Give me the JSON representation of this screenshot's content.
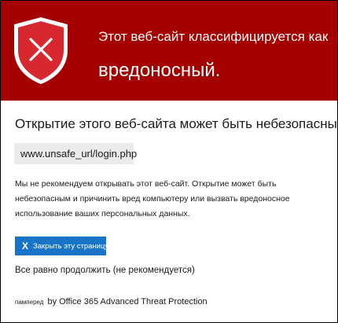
{
  "banner": {
    "line1": "Этот веб-сайт классифицируется как",
    "line2": "вредоносный.",
    "icon": "shield-x-icon",
    "background_color": "#a40000",
    "shield_color": "#d8282f"
  },
  "main": {
    "heading": "Открытие этого веб-сайта может быть небезопасным.",
    "url": "www.unsafe_url/login.php",
    "description": "Мы не рекомендуем открывать этот веб-сайт. Открытие может быть небезопасным и причинить вред компьютеру или вызвать вредоносное использование ваших персональных данных."
  },
  "actions": {
    "close_icon": "X",
    "close_label": "Закрыть эту страницу",
    "close_color": "#1774c8",
    "continue_label": "Все равно продолжить (не рекомендуется)"
  },
  "footer": {
    "prefix": "памперед",
    "text": "by Office 365 Advanced Threat Protection"
  }
}
